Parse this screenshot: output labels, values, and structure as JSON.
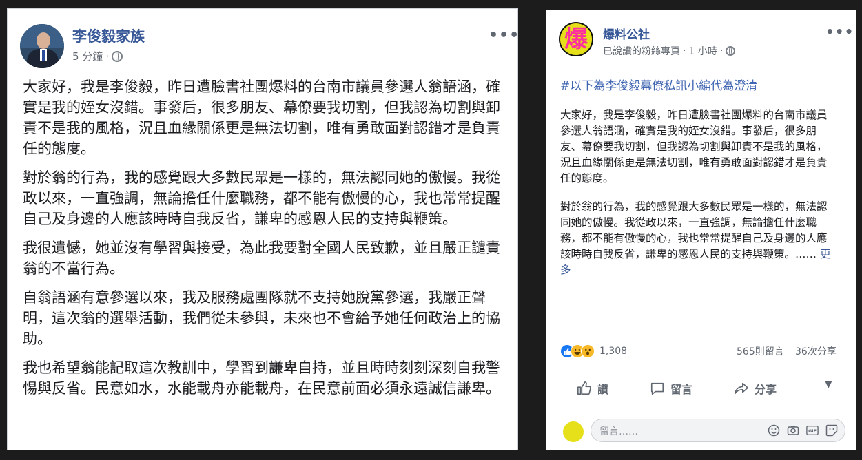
{
  "left_post": {
    "author": "李俊毅家族",
    "time": "5 分鐘",
    "time_separator": "·",
    "more": "•••",
    "paragraphs": [
      "大家好，我是李俊毅，昨日遭臉書社團爆料的台南市議員參選人翁語涵，確實是我的姪女沒錯。事發后，很多朋友、幕僚要我切割，但我認為切割與卸責不是我的風格，況且血緣關係更是無法切割，唯有勇敢面對認錯才是負責任的態度。",
      "對於翁的行為，我的感覺跟大多數民眾是一樣的，無法認同她的傲慢。我從政以來，一直強調，無論擔任什麼職務，都不能有傲慢的心，我也常常提醒自己及身邊的人應該時時自我反省，謙卑的感恩人民的支持與鞭策。",
      "我很遺憾，她並沒有學習與接受，為此我要對全國人民致歉，並且嚴正譴責翁的不當行為。",
      "自翁語涵有意參選以來，我及服務處團隊就不支持她脫黨參選，我嚴正聲明，這次翁的選舉活動，我們從未參與，未來也不會給予她任何政治上的協助。",
      "我也希望翁能記取這次教訓中，學習到謙卑自持，並且時時刻刻深刻自我警惕與反省。民意如水，水能載舟亦能載舟，在民意前面必須永遠誠信謙卑。"
    ]
  },
  "right_post": {
    "author": "爆料公社",
    "avatar_glyph": "爆",
    "meta": "已說讚的粉絲專頁",
    "time": "1 小時",
    "time_separator": "·",
    "more": "•••",
    "hashtag": "#以下為李俊毅幕僚私訊小編代為澄清",
    "paragraphs": [
      "大家好，我是李俊毅，昨日遭臉書社團爆料的台南市議員參選人翁語涵，確實是我的姪女沒錯。事發后，很多朋友、幕僚要我切割，但我認為切割與卸責不是我的風格，況且血緣關係更是無法切割，唯有勇敢面對認錯才是負責任的態度。",
      "對於翁的行為，我的感覺跟大多數民眾是一樣的，無法認同她的傲慢。我從政以來，一直強調，無論擔任什麼職務，都不能有傲慢的心，我也常常提醒自己及身邊的人應該時時自我反省，謙卑的感恩人民的支持與鞭策。……"
    ],
    "see_more": "更多",
    "reaction_count": "1,308",
    "comments": "565則留言",
    "shares": "36次分享",
    "actions": {
      "like": "讚",
      "comment": "留言",
      "share": "分享",
      "dropdown": "▼"
    },
    "comment_placeholder": "留言……",
    "icons": [
      "like-reaction",
      "haha-reaction",
      "wow-reaction",
      "emoji-icon",
      "camera-icon",
      "gif-icon",
      "sticker-icon"
    ],
    "colors": {
      "link": "#385898",
      "hashtag": "#4267b2",
      "like": "#1877f2"
    }
  }
}
